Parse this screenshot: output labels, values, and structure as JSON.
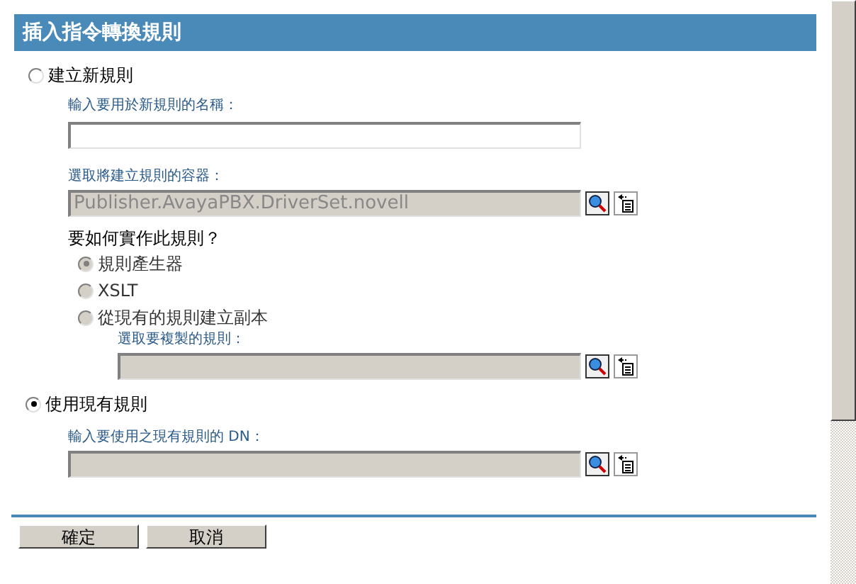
{
  "title": "插入指令轉換規則",
  "create_rule": {
    "label": "建立新規則",
    "selected": false,
    "name_field": {
      "label": "輸入要用於新規則的名稱："
    },
    "container_field": {
      "label": "選取將建立規則的容器：",
      "value": "Publisher.AvayaPBX.DriverSet.novell",
      "disabled": true
    },
    "method_question": "要如何實作此規則？",
    "methods": [
      {
        "label": "規則產生器",
        "selected": true,
        "disabled": true
      },
      {
        "label": "XSLT",
        "selected": false,
        "disabled": true
      },
      {
        "label": "從現有的規則建立副本",
        "selected": false,
        "disabled": true
      }
    ],
    "copy_field": {
      "label": "選取要複製的規則：",
      "disabled": true
    }
  },
  "use_existing": {
    "label": "使用現有規則",
    "selected": true,
    "dn_field": {
      "label": "輸入要使用之現有規則的 DN：",
      "disabled": true
    }
  },
  "buttons": [
    "確定",
    "取消"
  ]
}
